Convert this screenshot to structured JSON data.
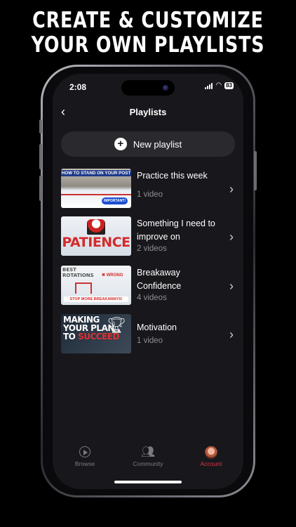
{
  "marketing": {
    "headline_line1": "CREATE & CUSTOMIZE",
    "headline_line2": "YOUR OWN PLAYLISTS"
  },
  "status_bar": {
    "time": "2:08",
    "battery": "83"
  },
  "header": {
    "back_icon": "chevron-left-icon",
    "title": "Playlists"
  },
  "new_playlist": {
    "icon": "plus-icon",
    "label": "New playlist"
  },
  "playlists": [
    {
      "name": "Practice this week",
      "count": "1 video",
      "thumbnail_text": [
        "HOW TO STAND ON YOUR POST",
        "IMPORTANT!"
      ]
    },
    {
      "name": "Something I need to improve on",
      "count": "2 videos",
      "thumbnail_text": [
        "PATIENCE"
      ]
    },
    {
      "name": "Breakaway Confidence",
      "count": "4 videos",
      "thumbnail_text": [
        "BEST",
        "ROTATIONS",
        "WRONG",
        "STOP MORE BREAKAWAYS!"
      ]
    },
    {
      "name": "Motivation",
      "count": "1 video",
      "thumbnail_text": [
        "MAKING",
        "YOUR PLAN",
        "TO",
        "SUCCEED"
      ]
    }
  ],
  "tabbar": {
    "items": [
      {
        "label": "Browse",
        "icon": "play-circle-icon",
        "active": false
      },
      {
        "label": "Community",
        "icon": "people-icon",
        "active": false
      },
      {
        "label": "Account",
        "icon": "avatar-icon",
        "active": true
      }
    ]
  },
  "colors": {
    "accent": "#e53245",
    "background": "#18181c",
    "row_background": "#2a2a2e"
  }
}
